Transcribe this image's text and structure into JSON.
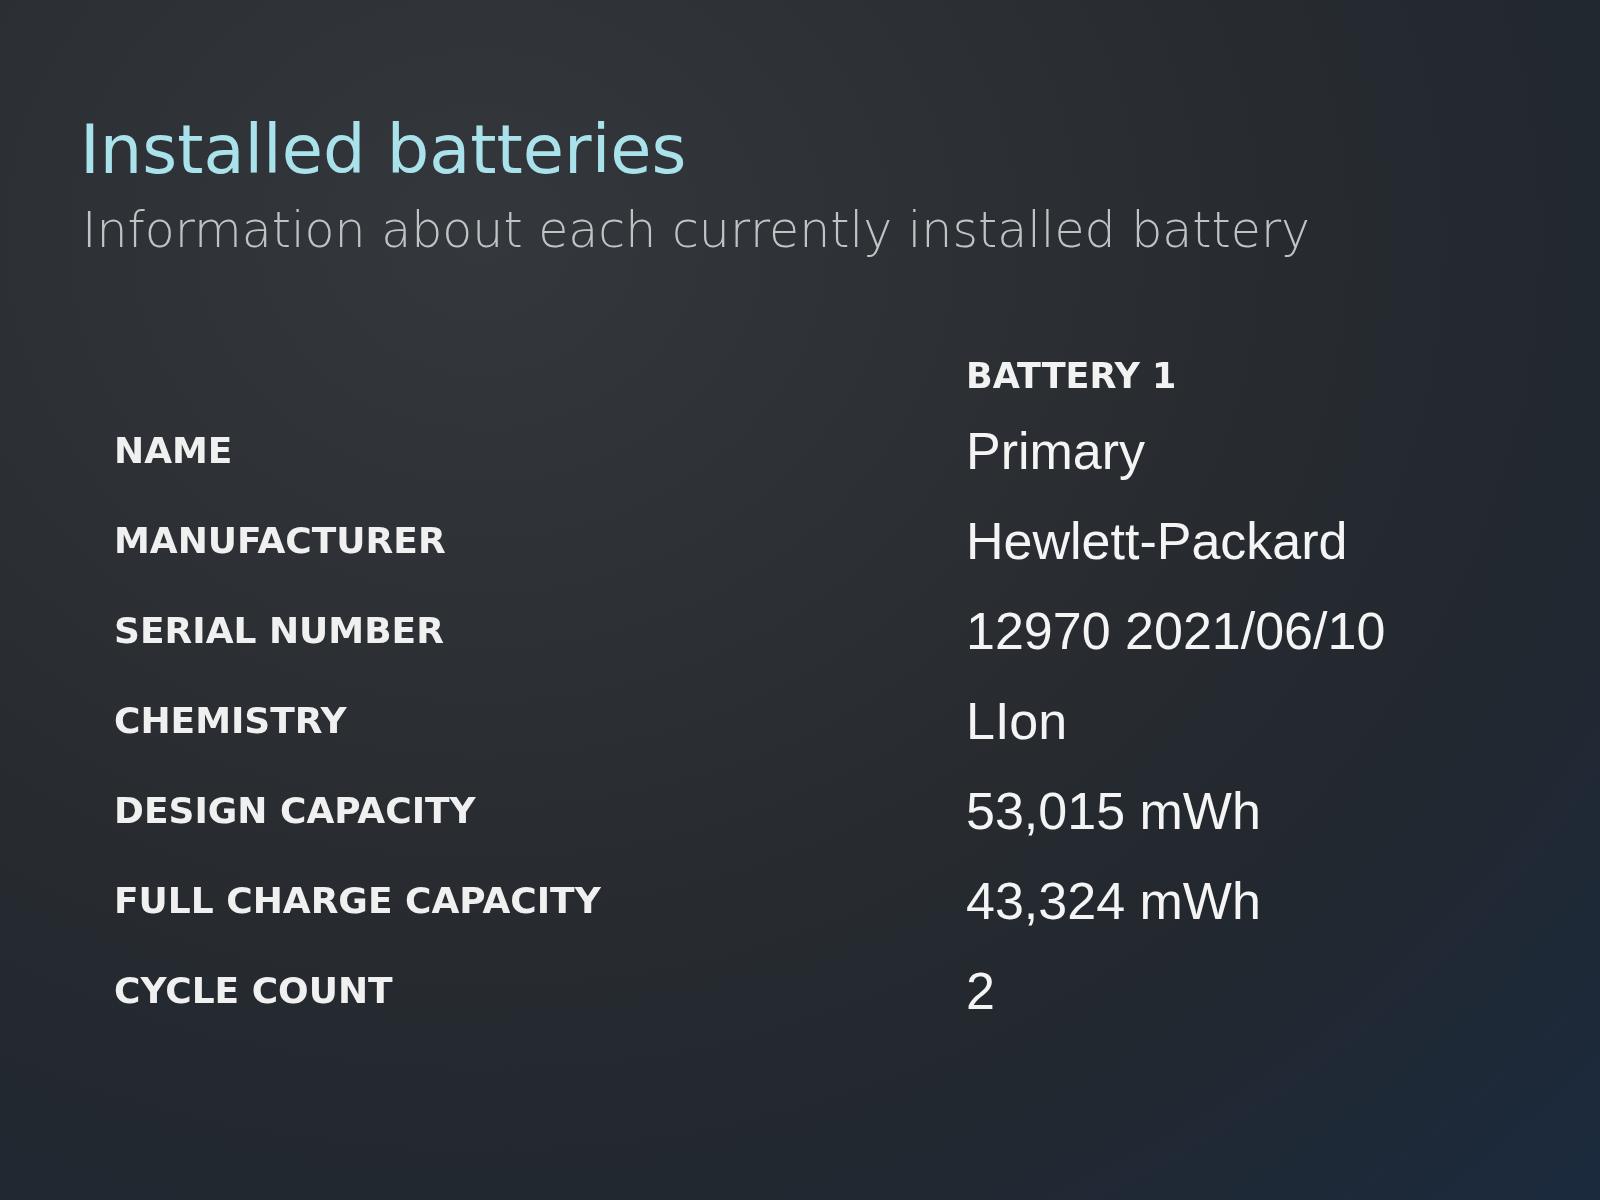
{
  "title": "Installed batteries",
  "subtitle": "Information about each currently installed battery",
  "table": {
    "columns": [
      "BATTERY 1"
    ],
    "rows": [
      {
        "label": "NAME",
        "values": [
          "Primary"
        ]
      },
      {
        "label": "MANUFACTURER",
        "values": [
          "Hewlett-Packard"
        ]
      },
      {
        "label": "SERIAL NUMBER",
        "values": [
          "12970 2021/06/10"
        ]
      },
      {
        "label": "CHEMISTRY",
        "values": [
          "LIon"
        ]
      },
      {
        "label": "DESIGN CAPACITY",
        "values": [
          "53,015 mWh"
        ]
      },
      {
        "label": "FULL CHARGE CAPACITY",
        "values": [
          "43,324 mWh"
        ]
      },
      {
        "label": "CYCLE COUNT",
        "values": [
          "2"
        ]
      }
    ]
  }
}
